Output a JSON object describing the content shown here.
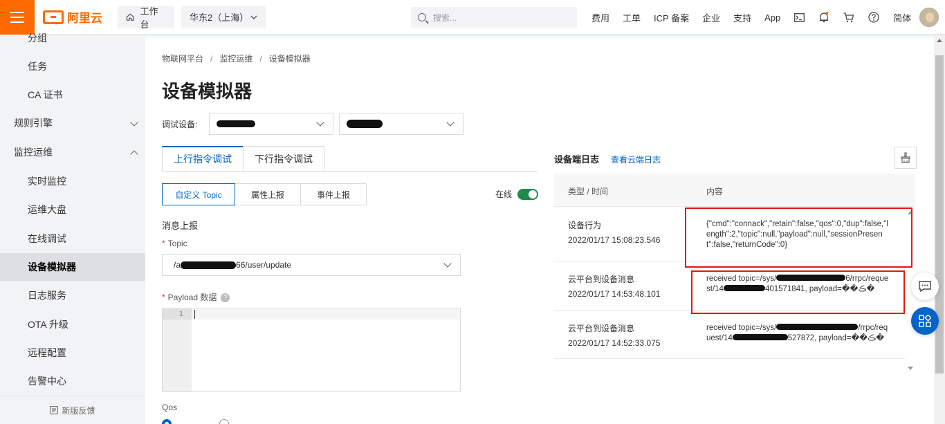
{
  "topbar": {
    "brand": "阿里云",
    "workbench": "工作台",
    "region": "华东2（上海）",
    "search_placeholder": "搜索...",
    "nav": [
      "费用",
      "工单",
      "ICP 备案",
      "企业",
      "支持",
      "App"
    ],
    "lang": "简体",
    "accent": "#ff6a00"
  },
  "sidebar": {
    "items": [
      {
        "label": "分组",
        "type": "sub"
      },
      {
        "label": "任务",
        "type": "sub"
      },
      {
        "label": "CA 证书",
        "type": "sub"
      },
      {
        "label": "规则引擎",
        "type": "group",
        "expanded": false
      },
      {
        "label": "监控运维",
        "type": "group",
        "expanded": true
      },
      {
        "label": "实时监控",
        "type": "sub"
      },
      {
        "label": "运维大盘",
        "type": "sub"
      },
      {
        "label": "在线调试",
        "type": "sub"
      },
      {
        "label": "设备模拟器",
        "type": "sub",
        "active": true
      },
      {
        "label": "日志服务",
        "type": "sub"
      },
      {
        "label": "OTA 升级",
        "type": "sub"
      },
      {
        "label": "远程配置",
        "type": "sub"
      },
      {
        "label": "告警中心",
        "type": "sub"
      }
    ],
    "footer": "新版反馈"
  },
  "breadcrumb": [
    "物联网平台",
    "监控运维",
    "设备模拟器"
  ],
  "page_title": "设备模拟器",
  "debug_device_label": "调试设备:",
  "tabs": [
    "上行指令调试",
    "下行指令调试"
  ],
  "segments": [
    "自定义 Topic",
    "属性上报",
    "事件上报"
  ],
  "online_label": "在线",
  "online": true,
  "section_title": "消息上报",
  "topic_label": "Topic",
  "topic_prefix": "/a",
  "topic_suffix": "66/user/update",
  "payload_label": "Payload 数据",
  "editor_line": "1",
  "qos_label": "Qos",
  "log": {
    "title": "设备端日志",
    "link": "查看云端日志",
    "col_type": "类型 / 时间",
    "col_content": "内容",
    "rows": [
      {
        "type": "设备行为",
        "time": "2022/01/17 15:08:23.546",
        "content": "{\"cmd\":\"connack\",\"retain\":false,\"qos\":0,\"dup\":false,\"length\":2,\"topic\":null,\"payload\":null,\"sessionPresent\":false,\"returnCode\":0}"
      },
      {
        "type": "云平台到设备消息",
        "time": "2022/01/17 14:53:48.101",
        "content_a": "received topic=/sys/",
        "content_b": "6/rrpc/request/14",
        "content_c": "401571841, payload=��ڪ�"
      },
      {
        "type": "云平台到设备消息",
        "time": "2022/01/17 14:52:33.075",
        "content_a": "received topic=/sys/",
        "content_b": "/rrpc/request/14",
        "content_c": "527872, payload=��ڪ�"
      }
    ]
  }
}
